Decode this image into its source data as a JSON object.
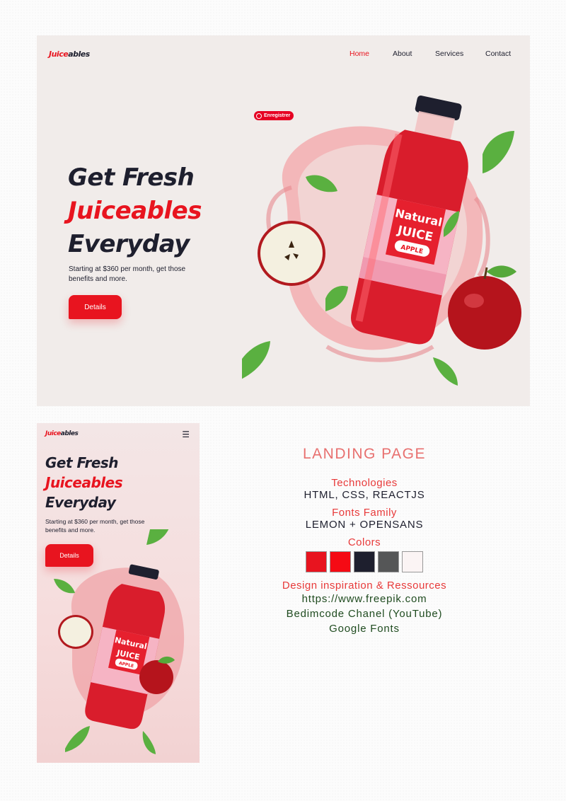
{
  "desktop": {
    "logo": {
      "prefix": "Juice",
      "suffix": "ables"
    },
    "nav": [
      {
        "label": "Home",
        "active": true
      },
      {
        "label": "About",
        "active": false
      },
      {
        "label": "Services",
        "active": false
      },
      {
        "label": "Contact",
        "active": false
      }
    ],
    "title": {
      "line1": "Get Fresh",
      "line2": "Juiceables",
      "line3": "Everyday"
    },
    "subtitle": "Starting at $360 per month, get those benefits and more.",
    "button_label": "Details",
    "save_label": "Enregistrer",
    "bottle": {
      "line1": "Natural",
      "line2": "JUICE",
      "line3": "APPLE"
    }
  },
  "mobile": {
    "logo": {
      "prefix": "Juice",
      "suffix": "ables"
    },
    "menu_icon": "hamburger-icon",
    "title": {
      "line1": "Get Fresh",
      "line2": "Juiceables",
      "line3": "Everyday"
    },
    "subtitle": "Starting at $360 per month, get those benefits and more.",
    "button_label": "Details",
    "bottle": {
      "line1": "Natural",
      "line2": "JUICE",
      "line3": "APPLE"
    }
  },
  "info": {
    "heading": "LANDING PAGE",
    "technologies_label": "Technologies",
    "technologies_value": "HTML, CSS, REACTJS",
    "fonts_label": "Fonts Family",
    "fonts_value": "LEMON + OPENSANS",
    "colors_label": "Colors",
    "colors": [
      "#e8141f",
      "#f50a14",
      "#1e1f2e",
      "#555657",
      "#fbf4f4"
    ],
    "resources_label": "Design inspiration & Ressources",
    "resources": [
      "https://www.freepik.com",
      "Bedimcode Chanel (YouTube)",
      "Google Fonts"
    ]
  },
  "theme": {
    "accent": "#e8141f",
    "dark": "#1e1f2e"
  }
}
